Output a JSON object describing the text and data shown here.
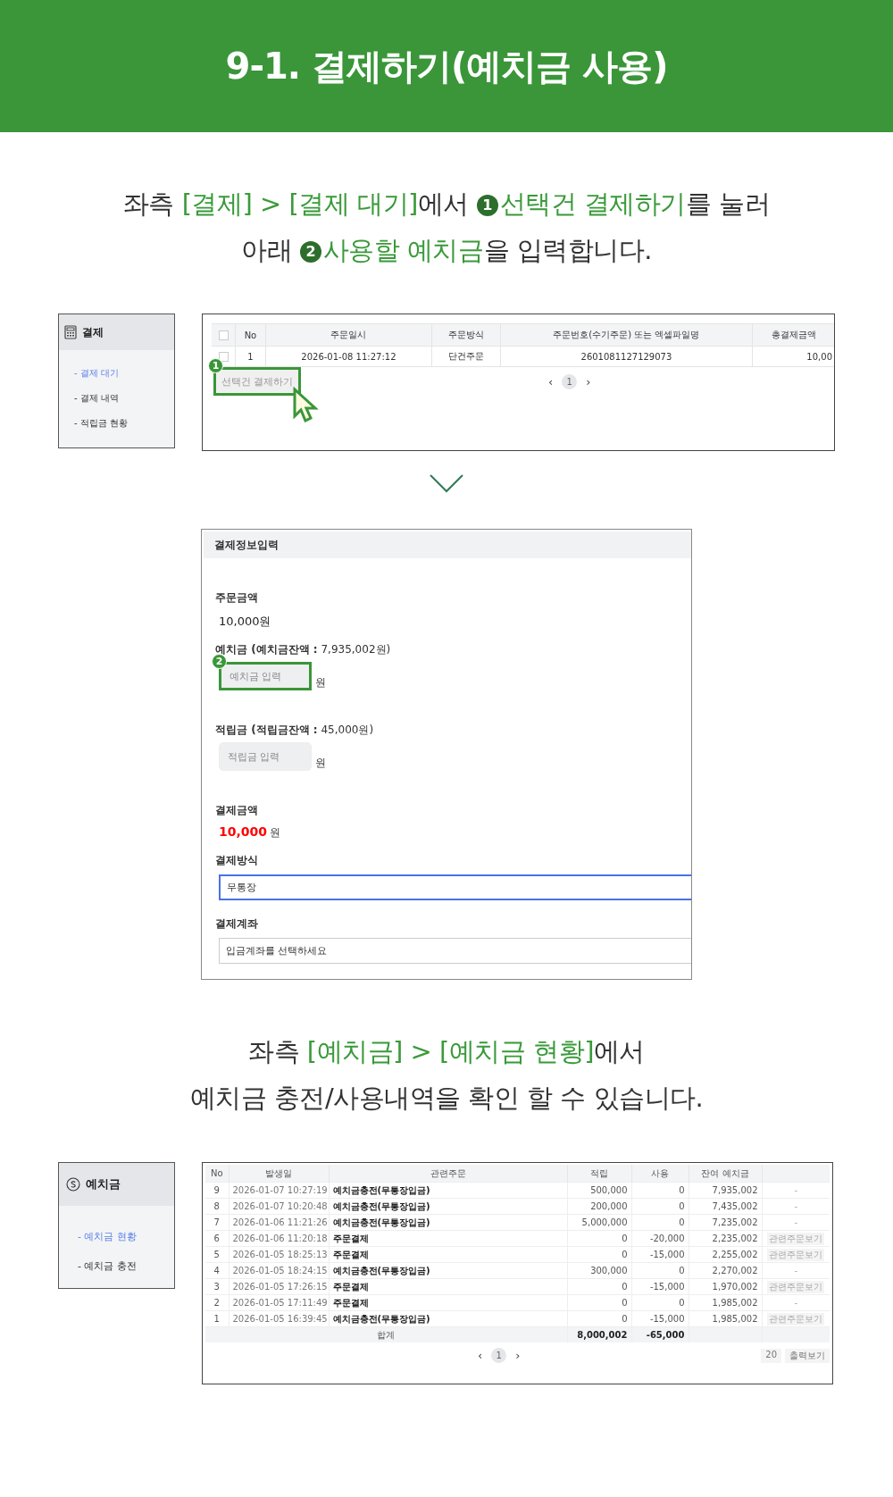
{
  "title": "9-1. 결제하기(예치금 사용)",
  "instruction_1": [
    [
      {
        "kind": "plain",
        "text": "좌측 "
      },
      {
        "kind": "accent",
        "text": "[결제] > [결제 대기]"
      },
      {
        "kind": "plain",
        "text": "에서 "
      },
      {
        "kind": "step",
        "text": "1"
      },
      {
        "kind": "accent",
        "text": "선택건 결제하기"
      },
      {
        "kind": "plain",
        "text": "를 눌러"
      }
    ],
    [
      {
        "kind": "plain",
        "text": "아래 "
      },
      {
        "kind": "step",
        "text": "2"
      },
      {
        "kind": "accent",
        "text": "사용할 예치금"
      },
      {
        "kind": "plain",
        "text": "을 입력합니다."
      }
    ]
  ],
  "payment_sidebar": {
    "title": "결제",
    "items": [
      {
        "label": "- 결제 대기",
        "selected": true
      },
      {
        "label": "- 결제 내역",
        "selected": false
      },
      {
        "label": "- 적립금 현황",
        "selected": false
      }
    ]
  },
  "order_table": {
    "select_all_checked": false,
    "columns": [
      "No",
      "주문일시",
      "주문방식",
      "주문번호(수기주문) 또는 엑셀파일명",
      "총결제금액"
    ],
    "rows": [
      {
        "checked": false,
        "cells": [
          "1",
          "2026-01-08 11:27:12",
          "단건주문",
          "2601081127129073",
          "10,00"
        ]
      }
    ],
    "action_button": {
      "label": "선택건 결제하기",
      "step": "1"
    },
    "pagination": {
      "prev": "‹",
      "pages": [
        {
          "label": "1",
          "selected": true
        }
      ],
      "next": "›"
    }
  },
  "payment_form": {
    "title": "결제정보입력",
    "fields": [
      {
        "kind": "amount",
        "label": "주문금액",
        "value": "10,000원"
      },
      {
        "kind": "input",
        "label": "**예치금 (예치금잔액 :** 7,935,002원)",
        "placeholder": "예치금 입력",
        "unit": "원",
        "step": "2"
      },
      {
        "kind": "input",
        "label": "**적립금 (적립금잔액 :** 45,000원)",
        "placeholder": "적립금 입력",
        "unit": "원"
      },
      {
        "kind": "total",
        "label": "결제금액",
        "value": "10,000",
        "unit": "원"
      },
      {
        "kind": "select",
        "label": "결제방식",
        "value": "무통장",
        "focused": true
      },
      {
        "kind": "select",
        "label": "결제계좌",
        "value": "입금계좌를 선택하세요",
        "focused": false
      }
    ]
  },
  "instruction_2": [
    [
      {
        "kind": "plain",
        "text": "좌측 "
      },
      {
        "kind": "accent",
        "text": "[예치금] > [예치금 현황]"
      },
      {
        "kind": "plain",
        "text": "에서"
      }
    ],
    [
      {
        "kind": "plain",
        "text": "예치금 충전/사용내역을 확인 할 수 있습니다."
      }
    ]
  ],
  "deposit_sidebar": {
    "title": "예치금",
    "items": [
      {
        "label": "- 예치금 현황",
        "selected": true
      },
      {
        "label": "- 예치금 충전",
        "selected": false
      }
    ]
  },
  "deposit_table": {
    "columns": [
      "No",
      "발생일",
      "관련주문",
      "적립",
      "사용",
      "잔여 예치금"
    ],
    "rows": [
      {
        "cells": [
          "9",
          "2026-01-07 10:27:19",
          "예치금충전(무통장입금)",
          "500,000",
          "0",
          "7,935,002"
        ],
        "action": {
          "kind": "text",
          "label": "-"
        }
      },
      {
        "cells": [
          "8",
          "2026-01-07 10:20:48",
          "예치금충전(무통장입금)",
          "200,000",
          "0",
          "7,435,002"
        ],
        "action": {
          "kind": "text",
          "label": "-"
        }
      },
      {
        "cells": [
          "7",
          "2026-01-06 11:21:26",
          "예치금충전(무통장입금)",
          "5,000,000",
          "0",
          "7,235,002"
        ],
        "action": {
          "kind": "text",
          "label": "-"
        }
      },
      {
        "cells": [
          "6",
          "2026-01-06 11:20:18",
          "주문결제",
          "0",
          "-20,000",
          "2,235,002"
        ],
        "action": {
          "kind": "button",
          "label": "관련주문보기"
        }
      },
      {
        "cells": [
          "5",
          "2026-01-05 18:25:13",
          "주문결제",
          "0",
          "-15,000",
          "2,255,002"
        ],
        "action": {
          "kind": "button",
          "label": "관련주문보기"
        }
      },
      {
        "cells": [
          "4",
          "2026-01-05 18:24:15",
          "예치금충전(무통장입금)",
          "300,000",
          "0",
          "2,270,002"
        ],
        "action": {
          "kind": "text",
          "label": "-"
        }
      },
      {
        "cells": [
          "3",
          "2026-01-05 17:26:15",
          "주문결제",
          "0",
          "-15,000",
          "1,970,002"
        ],
        "action": {
          "kind": "button",
          "label": "관련주문보기"
        }
      },
      {
        "cells": [
          "2",
          "2026-01-05 17:11:49",
          "주문결제",
          "0",
          "0",
          "1,985,002"
        ],
        "action": {
          "kind": "text",
          "label": "-"
        }
      },
      {
        "cells": [
          "1",
          "2026-01-05 16:39:45",
          "예치금충전(무통장입금)",
          "0",
          "-15,000",
          "1,985,002"
        ],
        "action": {
          "kind": "button",
          "label": "관련주문보기"
        }
      }
    ],
    "total": {
      "label": "합계",
      "earned": "8,000,002",
      "used": "-65,000"
    },
    "pagination": {
      "prev": "‹",
      "pages": [
        {
          "label": "1",
          "selected": true
        }
      ],
      "next": "›"
    },
    "page_size": "20",
    "export_button": "출력보기"
  }
}
